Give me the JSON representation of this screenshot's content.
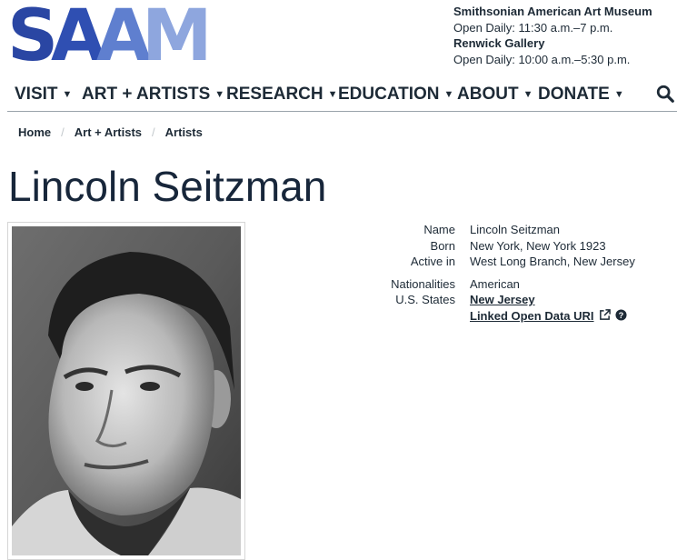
{
  "logo": {
    "letters": [
      "S",
      "A",
      "A",
      "M"
    ]
  },
  "museum": {
    "name1": "Smithsonian American Art Museum",
    "hours1": "Open Daily: 11:30 a.m.–7 p.m.",
    "name2": "Renwick Gallery",
    "hours2": "Open Daily: 10:00 a.m.–5:30 p.m."
  },
  "nav": {
    "items": [
      {
        "label": "VISIT"
      },
      {
        "label": "ART + ARTISTS"
      },
      {
        "label": "RESEARCH"
      },
      {
        "label": "EDUCATION"
      },
      {
        "label": "ABOUT"
      },
      {
        "label": "DONATE"
      }
    ],
    "search_icon": "search-icon"
  },
  "breadcrumb": [
    "Home",
    "Art + Artists",
    "Artists"
  ],
  "artist": {
    "name": "Lincoln Seitzman",
    "details": {
      "name_label": "Name",
      "name_value": "Lincoln Seitzman",
      "born_label": "Born",
      "born_value": "New York, New York  1923",
      "active_label": "Active in",
      "active_value": "West Long Branch, New Jersey",
      "nat_label": "Nationalities",
      "nat_value": "American",
      "states_label": "U.S. States",
      "states_value": "New Jersey",
      "lod_value": "Linked Open Data URI"
    }
  }
}
